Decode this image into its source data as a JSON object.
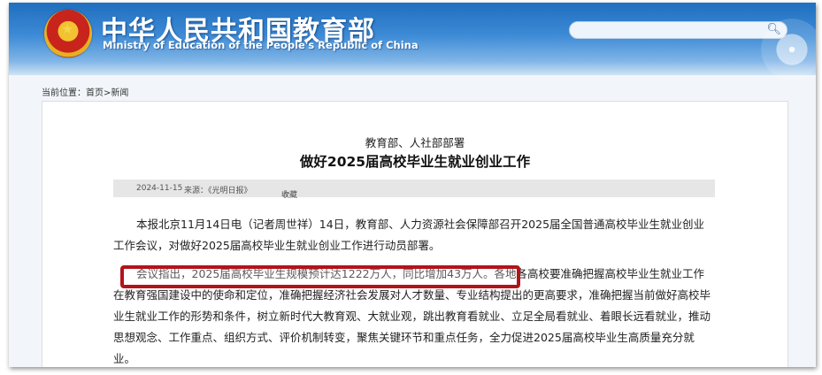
{
  "header": {
    "title_cn": "中华人民共和国教育部",
    "title_en": "Ministry of Education of the People's Republic of China",
    "search_placeholder": ""
  },
  "breadcrumb": {
    "label": "当前位置：",
    "items": [
      "首页",
      "新闻"
    ],
    "separator": ">"
  },
  "article": {
    "kicker": "教育部、人社部部署",
    "headline": "做好2025届高校毕业生就业创业工作",
    "date": "2024-11-15",
    "source": "来源：《光明日报》",
    "favorite_label": "收藏",
    "paragraph1": "本报北京11月14日电（记者周世祥）14日，教育部、人力资源社会保障部召开2025届全国普通高校毕业生就业创业工作会议，对做好2025届高校毕业生就业创业工作进行动员部署。",
    "paragraph2_highlight": "会议指出，2025届高校毕业生规模预计达1222万人，同比增加43万人。",
    "paragraph2_rest": "各地各高校要准确把握高校毕业生就业工作在教育强国建设中的使命和定位，准确把握经济社会发展对人才数量、专业结构提出的更高要求，准确把握当前做好高校毕业生就业工作的形势和条件，树立新时代大教育观、大就业观，跳出教育看就业、立足全局看就业、着眼长远看就业，推动思想观念、工作重点、组织方式、评价机制转变，聚焦关键环节和重点任务，全力促进2025届高校毕业生高质量充分就业。"
  },
  "colors": {
    "header_blue": "#1f6fbf",
    "highlight_red": "#b2131b",
    "meta_bar": "#e6e6e6"
  }
}
